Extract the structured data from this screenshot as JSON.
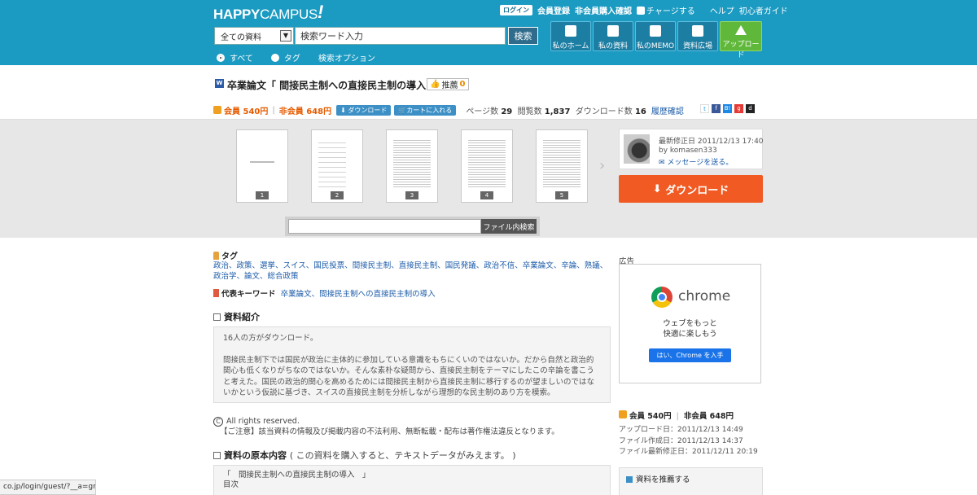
{
  "header": {
    "logo_bold": "HAPPY",
    "logo_normal": "CAMPUS",
    "logo_mark": "!",
    "topnav": {
      "login": "ログイン",
      "register": "会員登録",
      "guest_confirm": "非会員購入確認",
      "charge": "チャージする",
      "help": "ヘルプ",
      "beginner": "初心者ガイド"
    },
    "search": {
      "category": "全ての資料",
      "placeholder": "検索ワード入力",
      "button": "検索"
    },
    "radios": {
      "all": "すべて",
      "tag": "タグ",
      "options": "検索オプション",
      "selected": "すべて"
    },
    "nav": {
      "home": "私のホーム",
      "docs": "私の資料",
      "memo": "私のMEMO",
      "square": "資料広場",
      "upload": "アップロード"
    }
  },
  "doc": {
    "type_icon": "W",
    "title": "卒業論文「 間接民主制への直接民主制の導入 」",
    "recommend_label": "推薦",
    "recommend_count": "0",
    "member_price": "会員 540円",
    "separator": "|",
    "nonmember_price": "非会員 648円",
    "download_btn": "ダウンロード",
    "cart_btn": "カートに入れる",
    "pages_label": "ページ数",
    "pages": "29",
    "views_label": "閲覧数",
    "views": "1,837",
    "downloads_label": "ダウンロード数",
    "downloads": "16",
    "history": "履歴確認"
  },
  "social": [
    "t",
    "f",
    "B!",
    "g",
    "d"
  ],
  "preview": {
    "pages": [
      "1",
      "2",
      "3",
      "4",
      "5"
    ],
    "next": "›",
    "in_search_button": "ファイル内検索"
  },
  "author": {
    "updated": "最新修正日 2011/12/13 17:40",
    "by": "by komasen333",
    "message": "メッセージを送る。",
    "download_big": "ダウンロード"
  },
  "tags": {
    "heading": "タグ",
    "list": "政治、政策、選挙、スイス、国民投票、間接民主制、直接民主制、国民発議、政治不信、卒業論文、辛論、熟議、政治学、論文、総合政策"
  },
  "keywords": {
    "heading": "代表キーワード",
    "list": "卒業論文、間接民主制への直接民主制の導入"
  },
  "intro": {
    "heading": "資料紹介",
    "count_line": "16人の方がダウンロード。",
    "body": "間接民主制下では国民が政治に主体的に参加している意識をもちにくいのではないか。だから自然と政治的関心も低くなりがちなのではないか。そんな素朴な疑問から、直接民主制をテーマにしたこの辛論を書こうと考えた。国民の政治的関心を高めるためには間接民主制から直接民主制に移行するのが望ましいのではないかという仮説に基づき、スイスの直接民主制を分析しながら理想的な民主制のあり方を模索。"
  },
  "copyright": {
    "symbol": "C",
    "line1": "All rights reserved.",
    "line2": "【ご注意】該当資料の情報及び掲載内容の不法利用、無断転載・配布は著作権法違反となります。"
  },
  "original": {
    "heading": "資料の原本内容",
    "sub": "( この資料を購入すると、テキストデータがみえます。 )",
    "line1": "「　間接民主制への直接民主制の導入　」",
    "line2": "目次"
  },
  "ad": {
    "label": "広告",
    "brand": "chrome",
    "line1": "ウェブをもっと",
    "line2": "快適に楽しもう",
    "button": "はい、Chrome を入手"
  },
  "right_info": {
    "member_price": "会員 540円",
    "separator": "|",
    "nonmember_price": "非会員 648円",
    "uploaded": "アップロード日：2011/12/13 14:49",
    "created": "ファイル作成日：2011/12/13 14:37",
    "modified": "ファイル最新修正日：2011/12/11 20:19",
    "recommend_box": "資料を推薦する"
  },
  "status_url": "co.jp/login/guest/?__a=gnb",
  "colors": {
    "header_bg": "#1b9ac2",
    "upload_green": "#5fb83a",
    "download_orange": "#f15a22",
    "price_orange": "#e65b00",
    "link_blue": "#1a5aa8"
  }
}
